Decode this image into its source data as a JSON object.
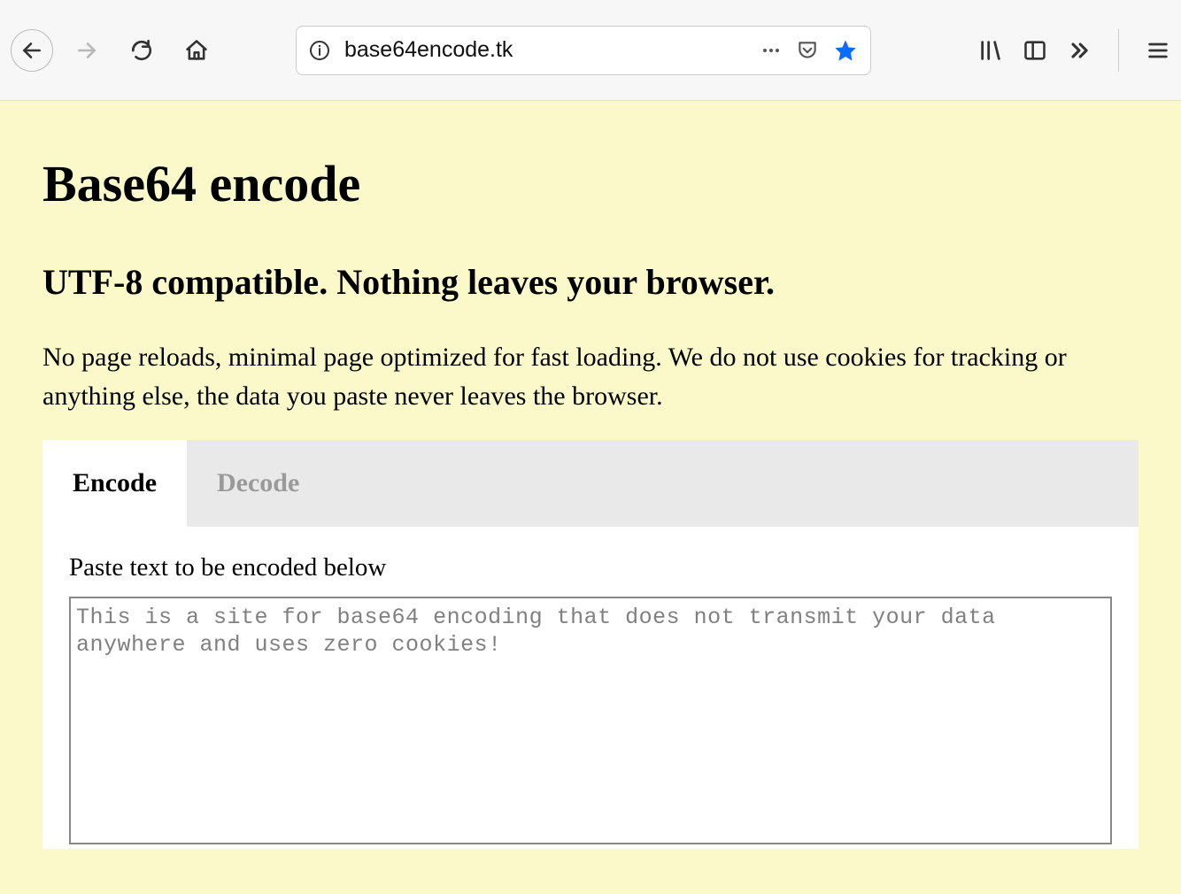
{
  "browser": {
    "url": "base64encode.tk"
  },
  "page": {
    "title": "Base64 encode",
    "subtitle": "UTF-8 compatible. Nothing leaves your browser.",
    "description": "No page reloads, minimal page optimized for fast loading. We do not use cookies for tracking or anything else, the data you paste never leaves the browser.",
    "tabs": {
      "encode": "Encode",
      "decode": "Decode"
    },
    "encode_prompt": "Paste text to be encoded below",
    "textarea_value": "This is a site for base64 encoding that does not transmit your data anywhere and uses zero cookies!"
  }
}
